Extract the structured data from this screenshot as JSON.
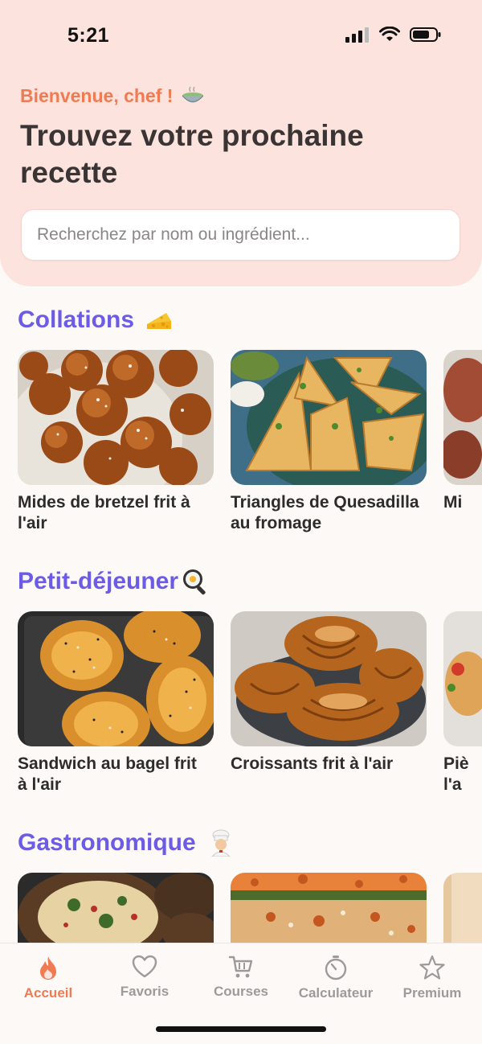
{
  "status_bar": {
    "time": "5:21"
  },
  "header": {
    "welcome": "Bienvenue, chef !",
    "headline": "Trouvez votre prochaine recette",
    "search_placeholder": "Recherchez par nom ou ingrédient..."
  },
  "colors": {
    "accent": "#f07b52",
    "section_title": "#6b5be6",
    "header_bg": "#fde3dd",
    "background": "#fdf9f6"
  },
  "sections": [
    {
      "title": "Collations",
      "emoji_icon": "cheese-icon",
      "cards": [
        {
          "title": "Mides de bretzel frit à l'air",
          "image_icon": "pretzel-bites-photo"
        },
        {
          "title": "Triangles de Quesadilla au fromage",
          "image_icon": "quesadilla-photo"
        },
        {
          "title": "Mi",
          "image_icon": "partial-photo"
        }
      ]
    },
    {
      "title": "Petit-déjeuner",
      "emoji_icon": "frying-pan-icon",
      "cards": [
        {
          "title": "Sandwich au bagel frit à l'air",
          "image_icon": "bagel-photo"
        },
        {
          "title": "Croissants frit à l'air",
          "image_icon": "croissant-photo"
        },
        {
          "title": "Piè l'a",
          "image_icon": "partial-photo"
        }
      ]
    },
    {
      "title": "Gastronomique",
      "emoji_icon": "chef-icon",
      "cards": [
        {
          "title": "",
          "image_icon": "stuffed-mushroom-photo"
        },
        {
          "title": "",
          "image_icon": "stuffed-zucchini-photo"
        },
        {
          "title": "",
          "image_icon": "partial-photo"
        }
      ]
    }
  ],
  "tabs": [
    {
      "label": "Accueil",
      "icon": "flame-icon",
      "active": true
    },
    {
      "label": "Favoris",
      "icon": "heart-icon",
      "active": false
    },
    {
      "label": "Courses",
      "icon": "cart-icon",
      "active": false
    },
    {
      "label": "Calculateur",
      "icon": "timer-icon",
      "active": false
    },
    {
      "label": "Premium",
      "icon": "star-icon",
      "active": false
    }
  ]
}
